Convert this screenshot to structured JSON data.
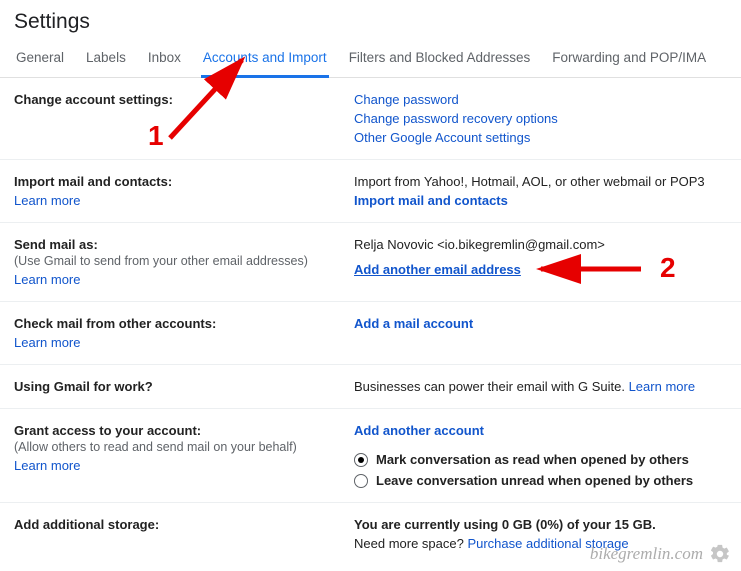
{
  "title": "Settings",
  "tabs": [
    {
      "label": "General",
      "active": false
    },
    {
      "label": "Labels",
      "active": false
    },
    {
      "label": "Inbox",
      "active": false
    },
    {
      "label": "Accounts and Import",
      "active": true
    },
    {
      "label": "Filters and Blocked Addresses",
      "active": false
    },
    {
      "label": "Forwarding and POP/IMA",
      "active": false
    }
  ],
  "sections": {
    "change_account": {
      "title": "Change account settings:",
      "links": [
        "Change password",
        "Change password recovery options",
        "Other Google Account settings"
      ]
    },
    "import_mail": {
      "title": "Import mail and contacts:",
      "learn_more": "Learn more",
      "desc": "Import from Yahoo!, Hotmail, AOL, or other webmail or POP3",
      "action": "Import mail and contacts"
    },
    "send_as": {
      "title": "Send mail as:",
      "sub": "(Use Gmail to send from your other email addresses)",
      "learn_more": "Learn more",
      "identity": "Relja Novovic <io.bikegremlin@gmail.com>",
      "action": "Add another email address"
    },
    "check_mail": {
      "title": "Check mail from other accounts:",
      "learn_more": "Learn more",
      "action": "Add a mail account"
    },
    "work": {
      "title": "Using Gmail for work?",
      "desc": "Businesses can power their email with G Suite. ",
      "learn_more": "Learn more"
    },
    "grant": {
      "title": "Grant access to your account:",
      "sub": "(Allow others to read and send mail on your behalf)",
      "learn_more": "Learn more",
      "action": "Add another account",
      "radio_read": "Mark conversation as read when opened by others",
      "radio_unread": "Leave conversation unread when opened by others"
    },
    "storage": {
      "title": "Add additional storage:",
      "desc_bold": "You are currently using 0 GB (0%) of your 15 GB.",
      "desc2": "Need more space? ",
      "purchase": "Purchase additional storage"
    }
  },
  "annotations": {
    "num1": "1",
    "num2": "2"
  },
  "watermark": "bikegremlin.com"
}
